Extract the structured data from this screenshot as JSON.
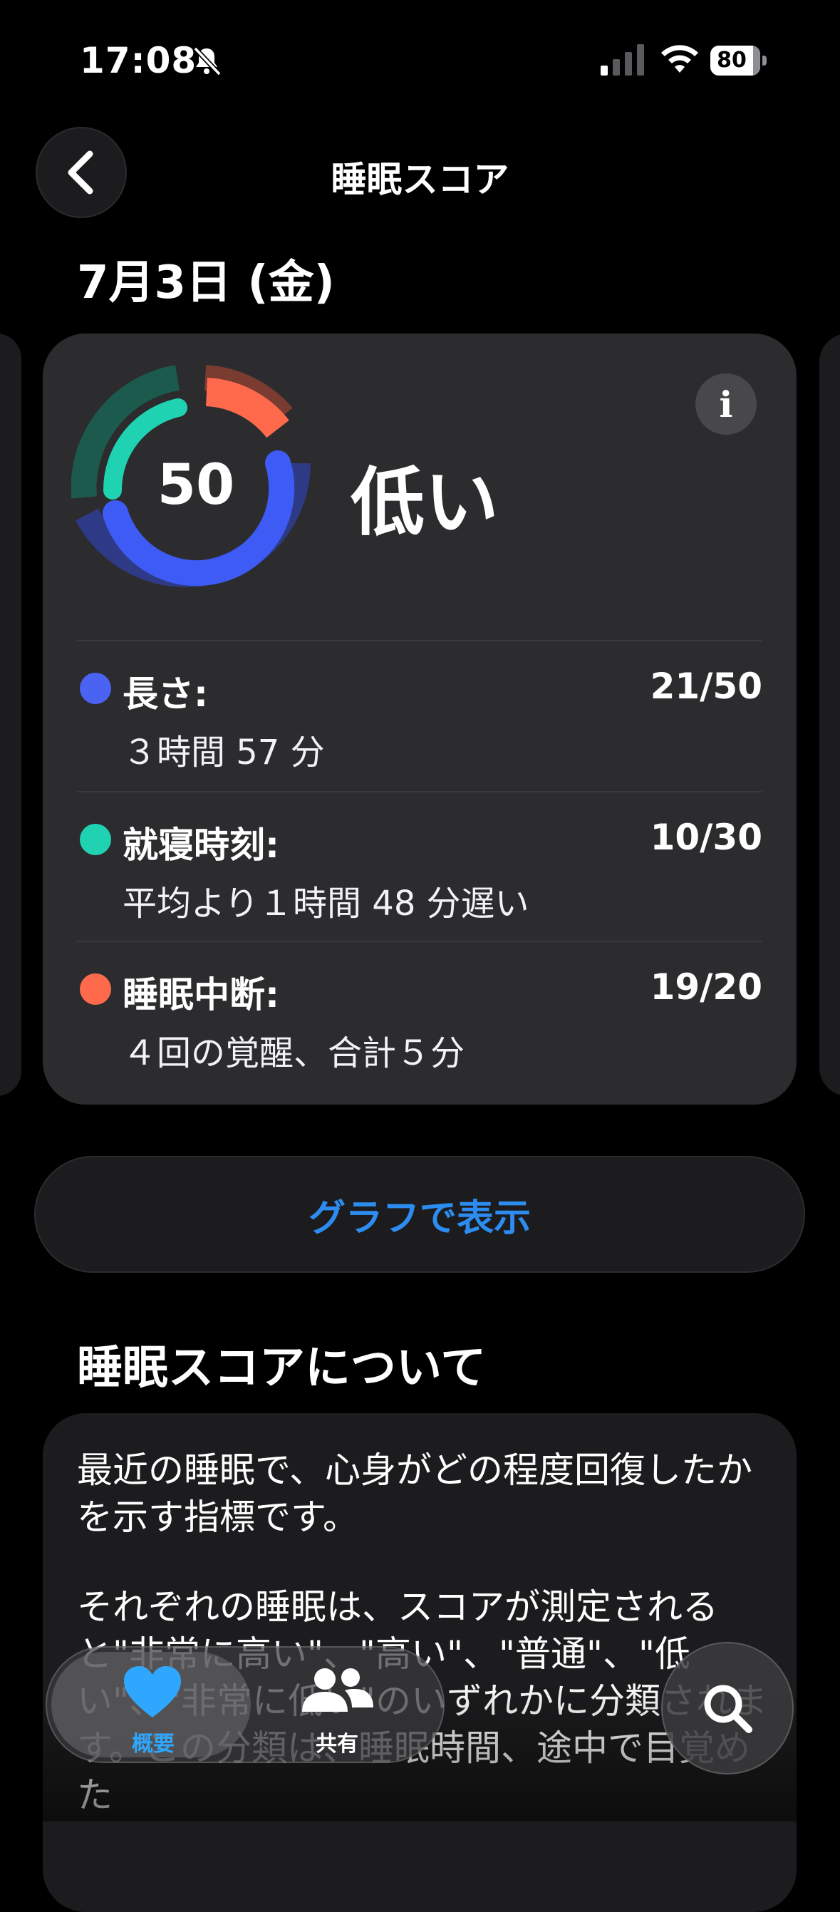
{
  "status_bar": {
    "time": "17:08",
    "battery": "80"
  },
  "nav": {
    "title": "睡眠スコア"
  },
  "date": "7月3日 (金)",
  "score_card": {
    "score": "50",
    "rating": "低い",
    "colors": {
      "duration": "#4a63f2",
      "bedtime": "#1fd3b2",
      "interruptions": "#ff6a4d"
    },
    "metrics": [
      {
        "label": "長さ:",
        "value": "21/50",
        "detail": "３時間 57 分",
        "fraction": 0.42
      },
      {
        "label": "就寝時刻:",
        "value": "10/30",
        "detail": "平均より１時間 48 分遅い",
        "fraction": 0.33
      },
      {
        "label": "睡眠中断:",
        "value": "19/20",
        "detail": "４回の覚醒、合計５分",
        "fraction": 0.95
      }
    ]
  },
  "graph_button": "グラフで表示",
  "about": {
    "title": "睡眠スコアについて",
    "paragraph1": "最近の睡眠で、心身がどの程度回復したかを示す指標です。",
    "paragraph2": "それぞれの睡眠は、スコアが測定されると\"非常に高い\"、\"高い\"、\"普通\"、\"低い\"、\"非常に低い\"のいずれかに分類されます。この分類は、睡眠時間、途中で目覚めた"
  },
  "tabbar": {
    "summary": "概要",
    "share": "共有"
  },
  "icons": [
    "back-icon",
    "info-icon",
    "heart-icon",
    "people-icon",
    "search-icon",
    "bell-slash-icon",
    "wifi-icon",
    "signal-icon"
  ]
}
